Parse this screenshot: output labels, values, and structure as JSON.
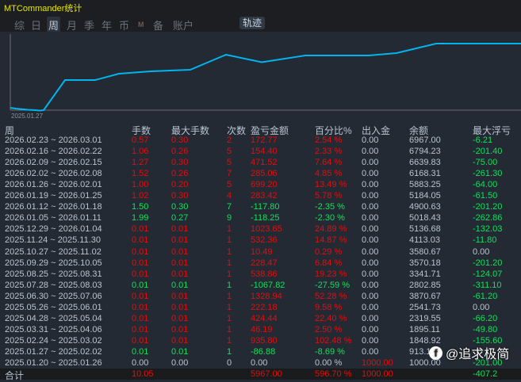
{
  "title": "MTCommander统计",
  "tabs": [
    "综",
    "日",
    "周",
    "月",
    "季",
    "年",
    "币",
    "M",
    "备",
    "账户"
  ],
  "selected_tab": "周",
  "trail_button": "轨迹",
  "chart": {
    "x_start_label": "2025.01.27",
    "line_color": "#00b4f0"
  },
  "columns": [
    "周",
    "手数",
    "最大手数",
    "次数",
    "盈亏金额",
    "百分比%",
    "出入金",
    "余额",
    "最大浮亏"
  ],
  "rows": [
    {
      "week": "2026.02.23 ~ 2026.03.01",
      "lots": "0.57",
      "max_lots": "0.30",
      "count": "2",
      "pnl": "172.77",
      "pct": "2.54 %",
      "dep": "0.00",
      "bal": "6967.00",
      "float": "-6.21",
      "tone": "red"
    },
    {
      "week": "2026.02.16 ~ 2026.02.22",
      "lots": "1.06",
      "max_lots": "0.26",
      "count": "5",
      "pnl": "154.40",
      "pct": "2.33 %",
      "dep": "0.00",
      "bal": "6794.23",
      "float": "-201.40",
      "tone": "red"
    },
    {
      "week": "2026.02.09 ~ 2026.02.15",
      "lots": "1.27",
      "max_lots": "0.30",
      "count": "5",
      "pnl": "471.52",
      "pct": "7.64 %",
      "dep": "0.00",
      "bal": "6639.83",
      "float": "-75.00",
      "tone": "red"
    },
    {
      "week": "2026.02.02 ~ 2026.02.08",
      "lots": "1.52",
      "max_lots": "0.26",
      "count": "7",
      "pnl": "285.06",
      "pct": "4.85 %",
      "dep": "0.00",
      "bal": "6168.31",
      "float": "-261.30",
      "tone": "red"
    },
    {
      "week": "2026.01.26 ~ 2026.02.01",
      "lots": "1.00",
      "max_lots": "0.20",
      "count": "5",
      "pnl": "699.20",
      "pct": "13.49 %",
      "dep": "0.00",
      "bal": "5883.25",
      "float": "-64.00",
      "tone": "red"
    },
    {
      "week": "2026.01.19 ~ 2026.01.25",
      "lots": "1.02",
      "max_lots": "0.30",
      "count": "4",
      "pnl": "283.42",
      "pct": "5.78 %",
      "dep": "0.00",
      "bal": "5184.05",
      "float": "-61.50",
      "tone": "red"
    },
    {
      "week": "2026.01.12 ~ 2026.01.18",
      "lots": "1.50",
      "max_lots": "0.30",
      "count": "7",
      "pnl": "-117.80",
      "pct": "-2.35 %",
      "dep": "0.00",
      "bal": "4900.63",
      "float": "-201.20",
      "tone": "green"
    },
    {
      "week": "2026.01.05 ~ 2026.01.11",
      "lots": "1.99",
      "max_lots": "0.27",
      "count": "9",
      "pnl": "-118.25",
      "pct": "-2.30 %",
      "dep": "0.00",
      "bal": "5018.43",
      "float": "-262.86",
      "tone": "green"
    },
    {
      "week": "2025.12.29 ~ 2026.01.04",
      "lots": "0.01",
      "max_lots": "0.01",
      "count": "1",
      "pnl": "1023.65",
      "pct": "24.89 %",
      "dep": "0.00",
      "bal": "5136.68",
      "float": "-132.03",
      "tone": "red"
    },
    {
      "week": "2025.11.24 ~ 2025.11.30",
      "lots": "0.01",
      "max_lots": "0.01",
      "count": "1",
      "pnl": "532.36",
      "pct": "14.87 %",
      "dep": "0.00",
      "bal": "4113.03",
      "float": "-11.80",
      "tone": "red"
    },
    {
      "week": "2025.10.27 ~ 2025.11.02",
      "lots": "0.01",
      "max_lots": "0.01",
      "count": "1",
      "pnl": "10.49",
      "pct": "0.29 %",
      "dep": "0.00",
      "bal": "3580.67",
      "float": "0.00",
      "tone": "red"
    },
    {
      "week": "2025.09.29 ~ 2025.10.05",
      "lots": "0.01",
      "max_lots": "0.01",
      "count": "1",
      "pnl": "228.47",
      "pct": "6.84 %",
      "dep": "0.00",
      "bal": "3570.18",
      "float": "-201.20",
      "tone": "red"
    },
    {
      "week": "2025.08.25 ~ 2025.08.31",
      "lots": "0.01",
      "max_lots": "0.01",
      "count": "1",
      "pnl": "538.86",
      "pct": "19.23 %",
      "dep": "0.00",
      "bal": "3341.71",
      "float": "-124.07",
      "tone": "red"
    },
    {
      "week": "2025.07.28 ~ 2025.08.03",
      "lots": "0.01",
      "max_lots": "0.01",
      "count": "1",
      "pnl": "-1067.82",
      "pct": "-27.59 %",
      "dep": "0.00",
      "bal": "2802.85",
      "float": "-311.10",
      "tone": "green"
    },
    {
      "week": "2025.06.30 ~ 2025.07.06",
      "lots": "0.01",
      "max_lots": "0.01",
      "count": "1",
      "pnl": "1328.94",
      "pct": "52.28 %",
      "dep": "0.00",
      "bal": "3870.67",
      "float": "-61.20",
      "tone": "red"
    },
    {
      "week": "2025.05.26 ~ 2025.06.01",
      "lots": "0.01",
      "max_lots": "0.01",
      "count": "1",
      "pnl": "222.18",
      "pct": "9.58 %",
      "dep": "0.00",
      "bal": "2541.73",
      "float": "0.00",
      "tone": "red"
    },
    {
      "week": "2025.04.28 ~ 2025.05.04",
      "lots": "0.01",
      "max_lots": "0.01",
      "count": "1",
      "pnl": "424.44",
      "pct": "22.40 %",
      "dep": "0.00",
      "bal": "2319.55",
      "float": "-66.20",
      "tone": "red"
    },
    {
      "week": "2025.03.31 ~ 2025.04.06",
      "lots": "0.01",
      "max_lots": "0.01",
      "count": "1",
      "pnl": "46.19",
      "pct": "2.50 %",
      "dep": "0.00",
      "bal": "1895.11",
      "float": "-49.80",
      "tone": "red"
    },
    {
      "week": "2025.02.24 ~ 2025.03.02",
      "lots": "0.01",
      "max_lots": "0.01",
      "count": "1",
      "pnl": "935.80",
      "pct": "102.48 %",
      "dep": "0.00",
      "bal": "1848.92",
      "float": "-155.60",
      "tone": "red"
    },
    {
      "week": "2025.01.27 ~ 2025.02.02",
      "lots": "0.01",
      "max_lots": "0.01",
      "count": "1",
      "pnl": "-86.88",
      "pct": "-8.69 %",
      "dep": "0.00",
      "bal": "913.1",
      "float": "",
      "tone": "green"
    },
    {
      "week": "2025.01.20 ~ 2025.01.26",
      "lots": "0.00",
      "max_lots": "0.00",
      "count": "0",
      "pnl": "0.00",
      "pct": "0.00 %",
      "dep": "1000.00",
      "bal": "1000.00",
      "float": "-201.00",
      "tone": "gray"
    }
  ],
  "total": {
    "label": "合计",
    "lots": "10.05",
    "pnl": "5967.00",
    "pct": "596.70 %",
    "dep": "1000.00",
    "float": "-407.2"
  },
  "watermark": "@追求极简",
  "colors": {
    "profit": "#e30d0d",
    "loss": "#14e05a",
    "neutral": "#b9c4d2"
  }
}
